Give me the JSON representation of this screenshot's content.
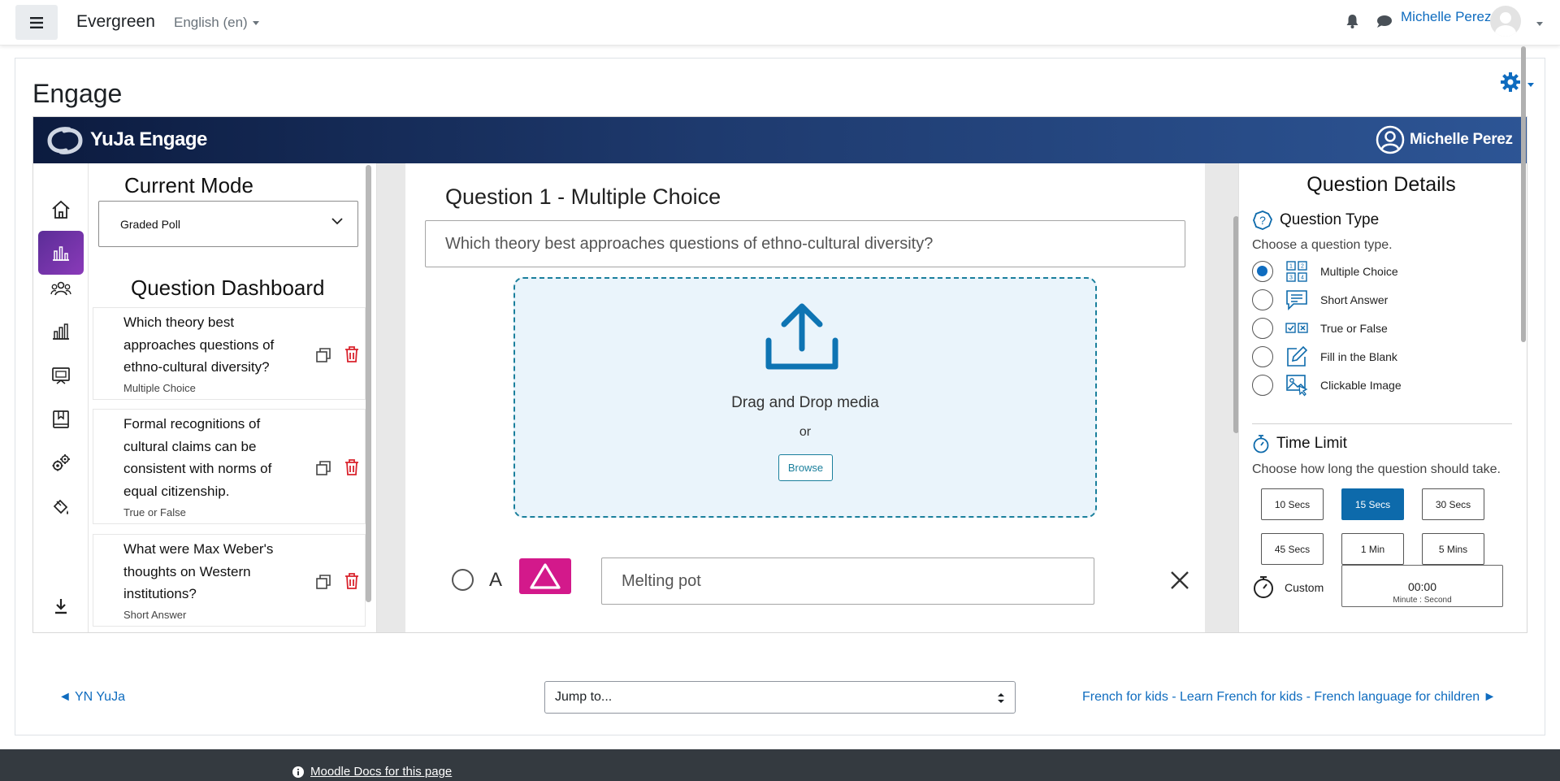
{
  "topnav": {
    "brand": "Evergreen",
    "language": "English (en)",
    "user_name": "Michelle Perez"
  },
  "page": {
    "title": "Engage"
  },
  "yuja": {
    "brand": "YuJa Engage",
    "user_name": "Michelle Perez",
    "rail": [
      "home-icon",
      "poll-chart-icon",
      "group-icon",
      "bar-chart-icon",
      "screen-icon",
      "bookmark-book-icon",
      "settings-gears-icon",
      "paint-bucket-icon",
      "download-icon"
    ],
    "left_panel": {
      "current_mode_title": "Current Mode",
      "mode_value": "Graded Poll",
      "dashboard_title": "Question Dashboard",
      "questions": [
        {
          "text": "Which theory best approaches questions of ethno-cultural diversity?",
          "type": "Multiple Choice"
        },
        {
          "text": "Formal recognitions of cultural claims can be consistent with norms of equal citizenship.",
          "type": "True or False"
        },
        {
          "text": "What were Max Weber's thoughts on Western institutions?",
          "type": "Short Answer"
        }
      ]
    },
    "center": {
      "heading": "Question 1 - Multiple Choice",
      "question_value": "Which theory best approaches questions of ethno-cultural diversity?",
      "drop_text": "Drag and Drop media",
      "drop_or": "or",
      "browse_label": "Browse",
      "answer_letter": "A",
      "answer_value": "Melting pot"
    },
    "right_panel": {
      "title": "Question Details",
      "question_type_title": "Question Type",
      "question_type_hint": "Choose a question type.",
      "question_types": [
        {
          "label": "Multiple Choice",
          "icon": "multiple-choice-grid-icon",
          "selected": true
        },
        {
          "label": "Short Answer",
          "icon": "short-answer-icon",
          "selected": false
        },
        {
          "label": "True or False",
          "icon": "true-false-icon",
          "selected": false
        },
        {
          "label": "Fill in the Blank",
          "icon": "fill-blank-pencil-icon",
          "selected": false
        },
        {
          "label": "Clickable Image",
          "icon": "clickable-image-icon",
          "selected": false
        }
      ],
      "time_limit_title": "Time Limit",
      "time_limit_hint": "Choose how long the question should take.",
      "time_options": [
        {
          "label": "10 Secs",
          "selected": false
        },
        {
          "label": "15 Secs",
          "selected": true
        },
        {
          "label": "30 Secs",
          "selected": false
        },
        {
          "label": "45 Secs",
          "selected": false
        },
        {
          "label": "1 Min",
          "selected": false
        },
        {
          "label": "5 Mins",
          "selected": false
        }
      ],
      "custom_label": "Custom",
      "custom_time": "00:00",
      "custom_sub": "Minute : Second"
    }
  },
  "activity_nav": {
    "prev_label": "◄ YN YuJa",
    "jump_placeholder": "Jump to...",
    "next_label": "French for kids - Learn French for kids - French language for children ►"
  },
  "footer": {
    "docs_link": "Moodle Docs for this page"
  },
  "colors": {
    "moodle_link": "#0f6cbf",
    "yuja_active": "#7a35ad",
    "selected_time": "#0d6aab",
    "answer_shape": "#d3198b",
    "delete_red": "#d9232d"
  }
}
